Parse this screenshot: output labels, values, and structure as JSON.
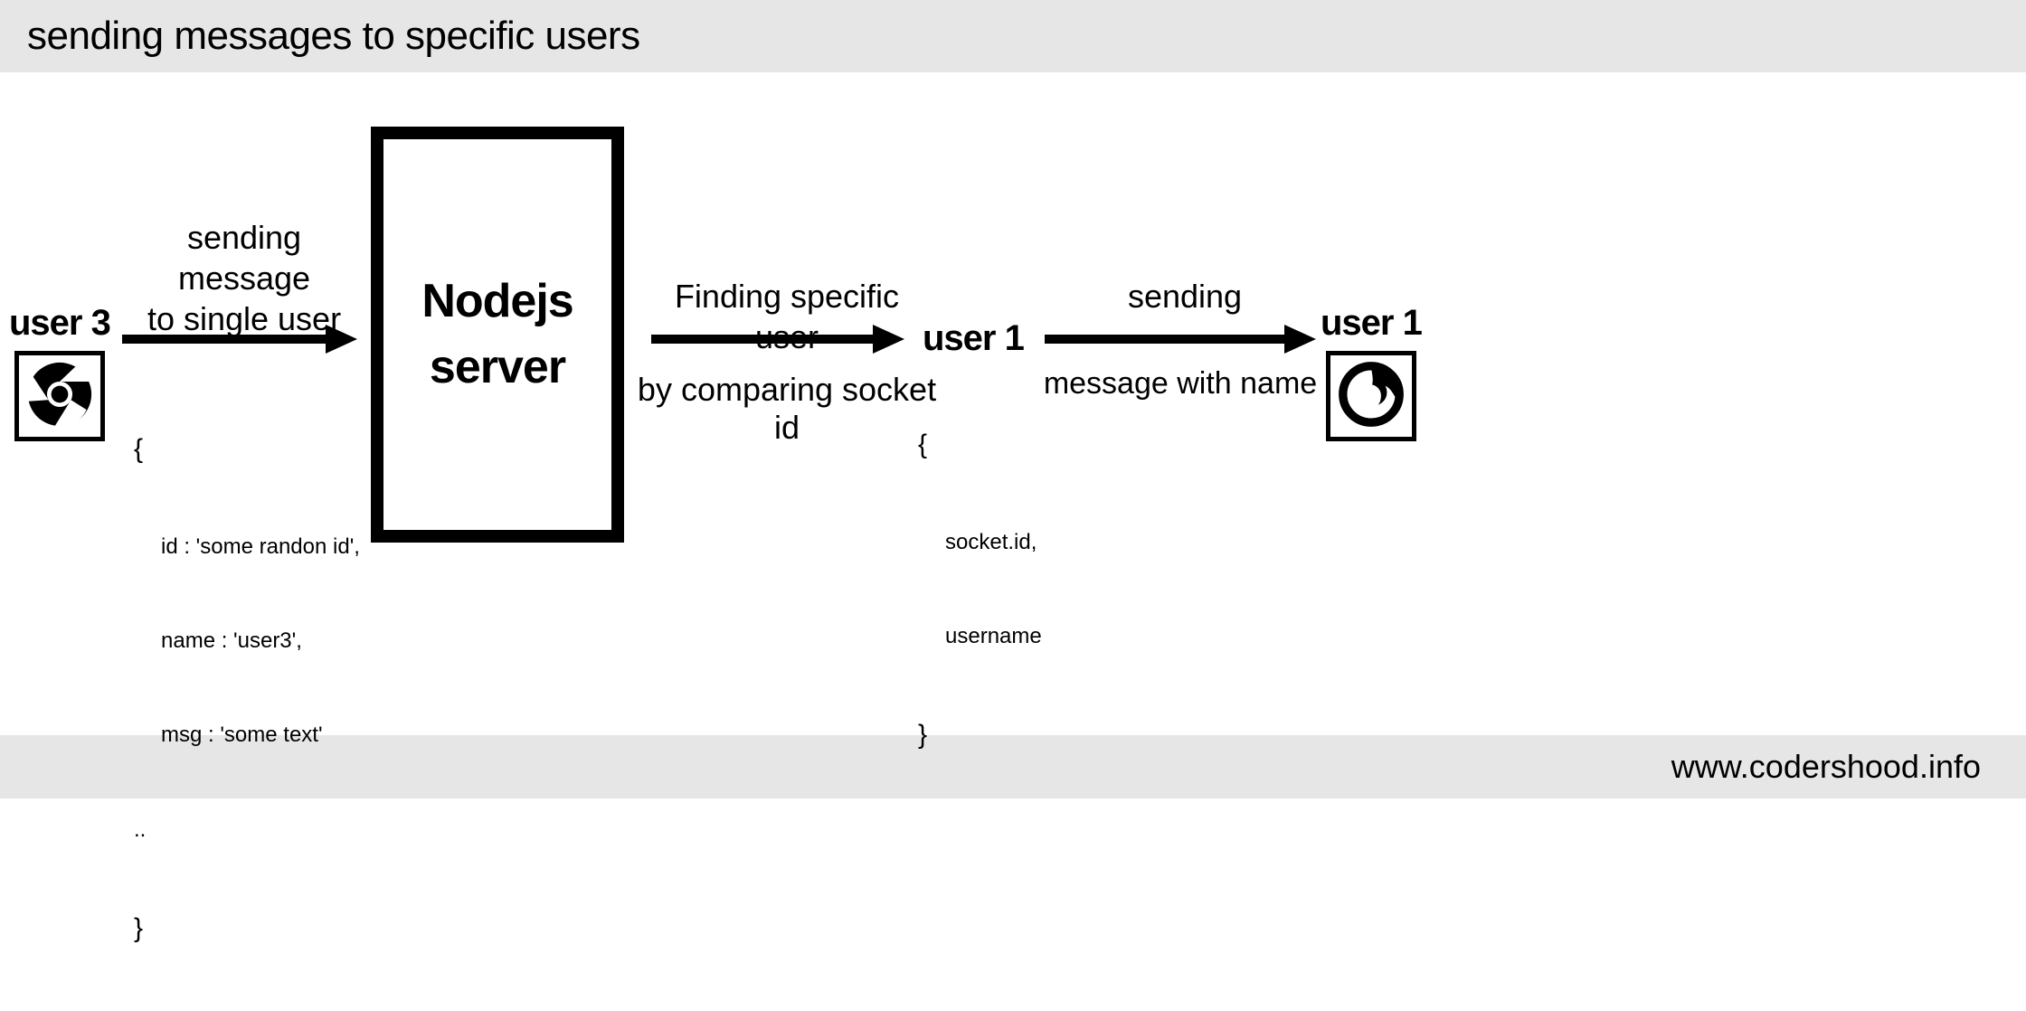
{
  "header": {
    "title": "sending messages to specific users"
  },
  "footer": {
    "url": "www.codershood.info"
  },
  "user_left": {
    "label": "user 3"
  },
  "user_mid": {
    "label": "user 1"
  },
  "user_right": {
    "label": "user 1"
  },
  "server": {
    "line1": "Nodejs",
    "line2": "server"
  },
  "arrow1": {
    "top1": "sending message",
    "top2": "to single user"
  },
  "arrow2": {
    "top": "Finding specific user",
    "bottom": "by comparing socket id"
  },
  "arrow3": {
    "top": "sending",
    "bottom": "message with name"
  },
  "payload1": {
    "open": "{",
    "l1": "id : 'some randon id',",
    "l2": "name : 'user3',",
    "l3": "msg : 'some text'",
    "dots": "..",
    "close": "}"
  },
  "payload2": {
    "open": "{",
    "l1": "socket.id,",
    "l2": "username",
    "close": "}"
  }
}
